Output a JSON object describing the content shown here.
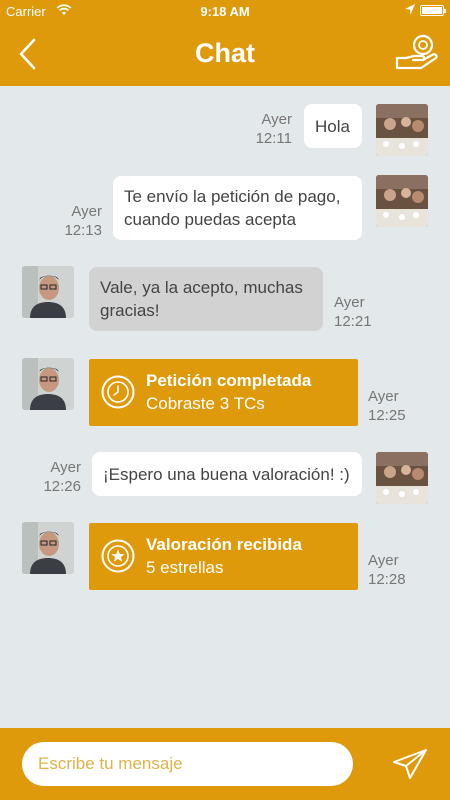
{
  "status_bar": {
    "carrier": "Carrier",
    "time": "9:18 AM"
  },
  "header": {
    "title": "Chat",
    "back_icon": "chevron-left-icon",
    "action_icon": "hand-coin-icon"
  },
  "colors": {
    "accent": "#df9a0b",
    "background": "#e3e8ea",
    "bubble_out": "#ffffff",
    "bubble_in": "#d2d2d2"
  },
  "messages": [
    {
      "type": "outgoing",
      "text": "Hola",
      "day": "Ayer",
      "time": "12:11"
    },
    {
      "type": "outgoing",
      "line1": "Te envío la petición de pago,",
      "line2": "cuando puedas acepta",
      "day": "Ayer",
      "time": "12:13"
    },
    {
      "type": "incoming",
      "line1": "Vale, ya la acepto, muchas",
      "line2": "gracias!",
      "day": "Ayer",
      "time": "12:21"
    },
    {
      "type": "system",
      "icon": "clock-icon",
      "title": "Petición completada",
      "subtitle": "Cobraste 3 TCs",
      "day": "Ayer",
      "time": "12:25"
    },
    {
      "type": "outgoing",
      "text": "¡Espero una buena valoración! :)",
      "day": "Ayer",
      "time": "12:26"
    },
    {
      "type": "system",
      "icon": "star-icon",
      "title": "Valoración recibida",
      "subtitle": "5 estrellas",
      "day": "Ayer",
      "time": "12:28"
    }
  ],
  "composer": {
    "placeholder": "Escribe tu mensaje",
    "send_icon": "paper-plane-icon"
  }
}
